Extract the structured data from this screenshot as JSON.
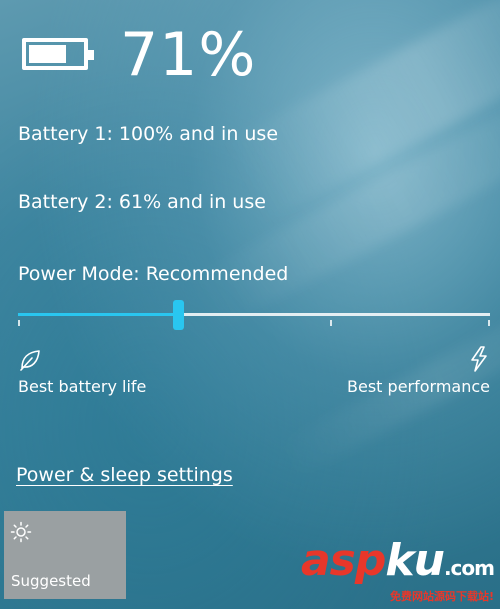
{
  "battery": {
    "percent_text": "71%",
    "level": 0.71,
    "battery1": "Battery 1: 100% and in use",
    "battery2": "Battery 2: 61% and in use"
  },
  "power_mode": {
    "label": "Power Mode: Recommended",
    "slider_position": 0.34,
    "accent_color": "#29c6f0",
    "left_end_label": "Best battery life",
    "right_end_label": "Best performance",
    "left_icon": "leaf-icon",
    "right_icon": "bolt-icon"
  },
  "link": {
    "settings": "Power & sleep settings"
  },
  "quick_action": {
    "label": "Suggested",
    "icon": "sun-icon"
  },
  "watermark": {
    "logo_red": "asp",
    "logo_white": "ku",
    "logo_suffix": ".com",
    "subtitle": "免费网站源码下载站!"
  }
}
